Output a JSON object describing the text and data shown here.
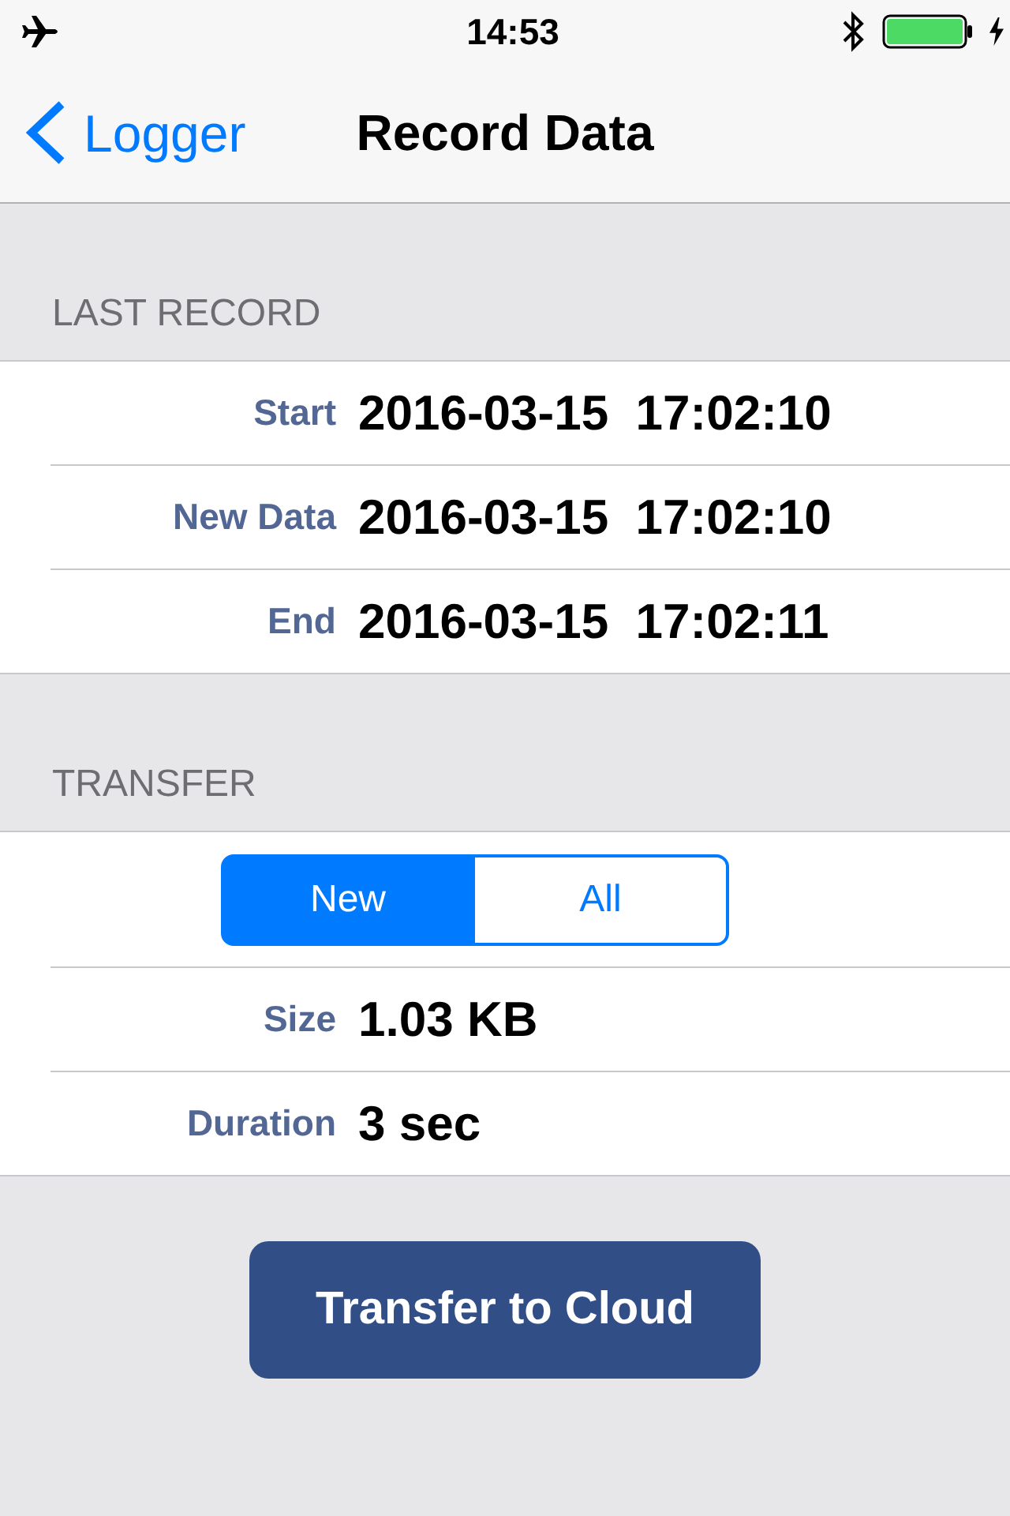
{
  "status_bar": {
    "time": "14:53"
  },
  "nav_bar": {
    "back": "Logger",
    "title": "Record Data"
  },
  "sections": [
    {
      "header": "LAST RECORD",
      "rows": [
        {
          "kind": "field",
          "label": "Start",
          "value": "2016-03-15  17:02:10"
        },
        {
          "kind": "field",
          "label": "New Data",
          "value": "2016-03-15  17:02:10"
        },
        {
          "kind": "field",
          "label": "End",
          "value": "2016-03-15  17:02:11"
        }
      ]
    },
    {
      "header": "TRANSFER",
      "rows": [
        {
          "kind": "segmented",
          "segments": [
            {
              "label": "New",
              "selected": true
            },
            {
              "label": "All",
              "selected": false
            }
          ]
        },
        {
          "kind": "field",
          "label": "Size",
          "value": "1.03 KB"
        },
        {
          "kind": "field",
          "label": "Duration",
          "value": "3 sec"
        }
      ]
    }
  ],
  "button": {
    "label": "Transfer to Cloud"
  }
}
